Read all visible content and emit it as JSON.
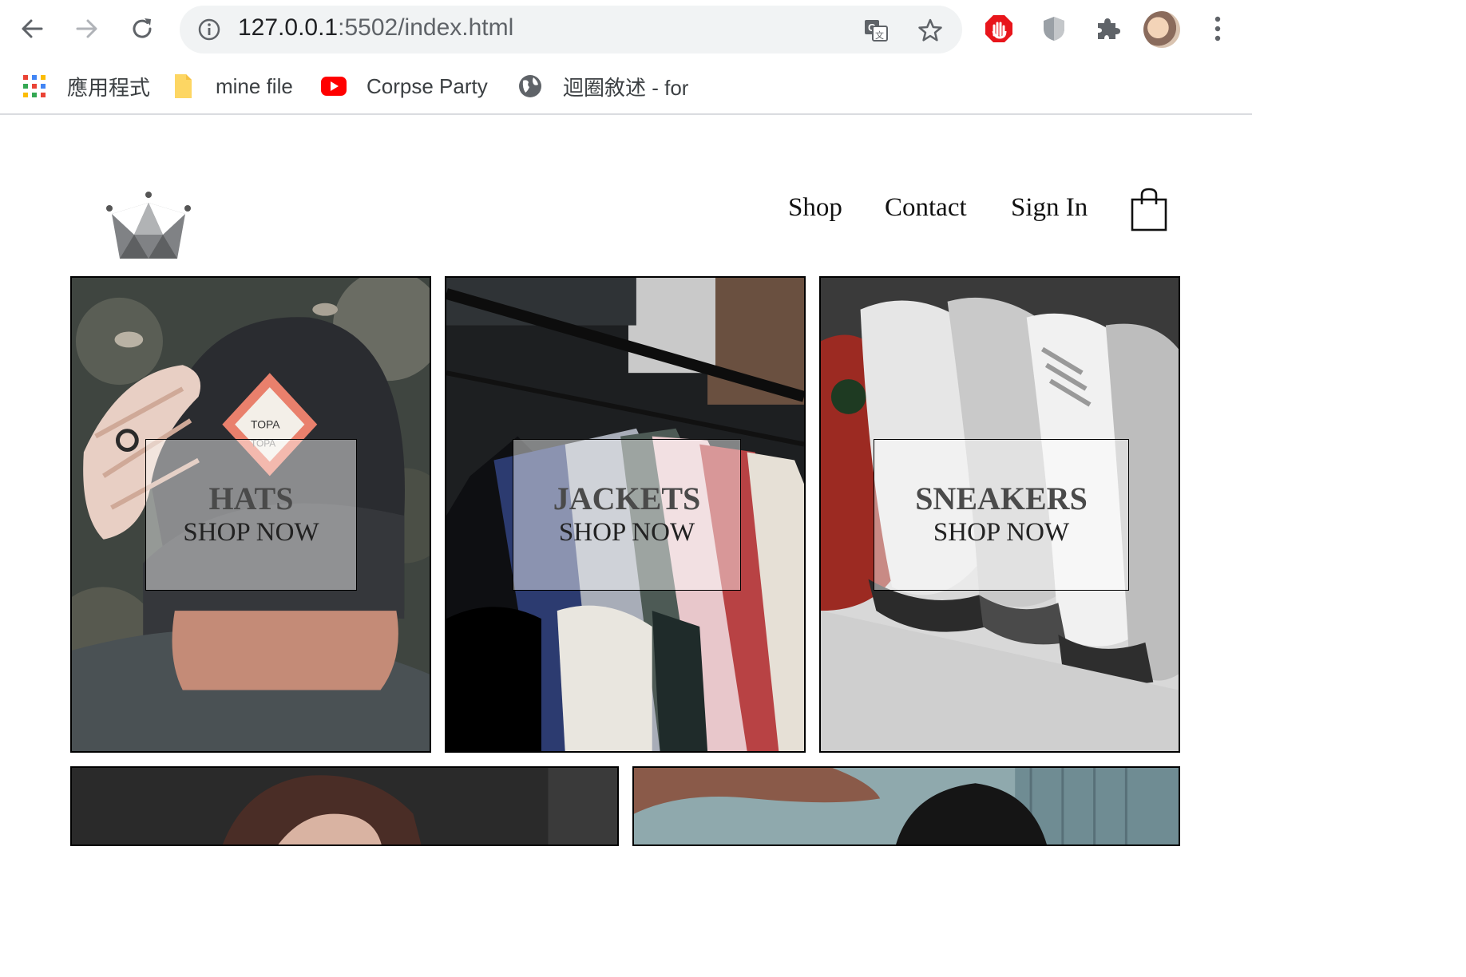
{
  "browser": {
    "url_host": "127.0.0.1",
    "url_rest": ":5502/index.html",
    "bookmarks": [
      {
        "label": "應用程式",
        "icon": "apps-grid-icon"
      },
      {
        "label": "mine file",
        "icon": "folder-icon"
      },
      {
        "label": "Corpse Party",
        "icon": "youtube-icon"
      },
      {
        "label": "迴圈敘述 - for",
        "icon": "globe-icon"
      }
    ]
  },
  "header": {
    "nav": {
      "shop": "Shop",
      "contact": "Contact",
      "sign_in": "Sign In"
    }
  },
  "directory": {
    "items": [
      {
        "title": "HATS",
        "subtitle": "SHOP NOW"
      },
      {
        "title": "JACKETS",
        "subtitle": "SHOP NOW"
      },
      {
        "title": "SNEAKERS",
        "subtitle": "SHOP NOW"
      },
      {
        "title": "",
        "subtitle": ""
      },
      {
        "title": "",
        "subtitle": ""
      }
    ]
  },
  "colors": {
    "chrome_bg": "#ffffff",
    "omnibox_bg": "#f1f3f4",
    "text_dark": "#111111",
    "tile_border": "#000000"
  }
}
